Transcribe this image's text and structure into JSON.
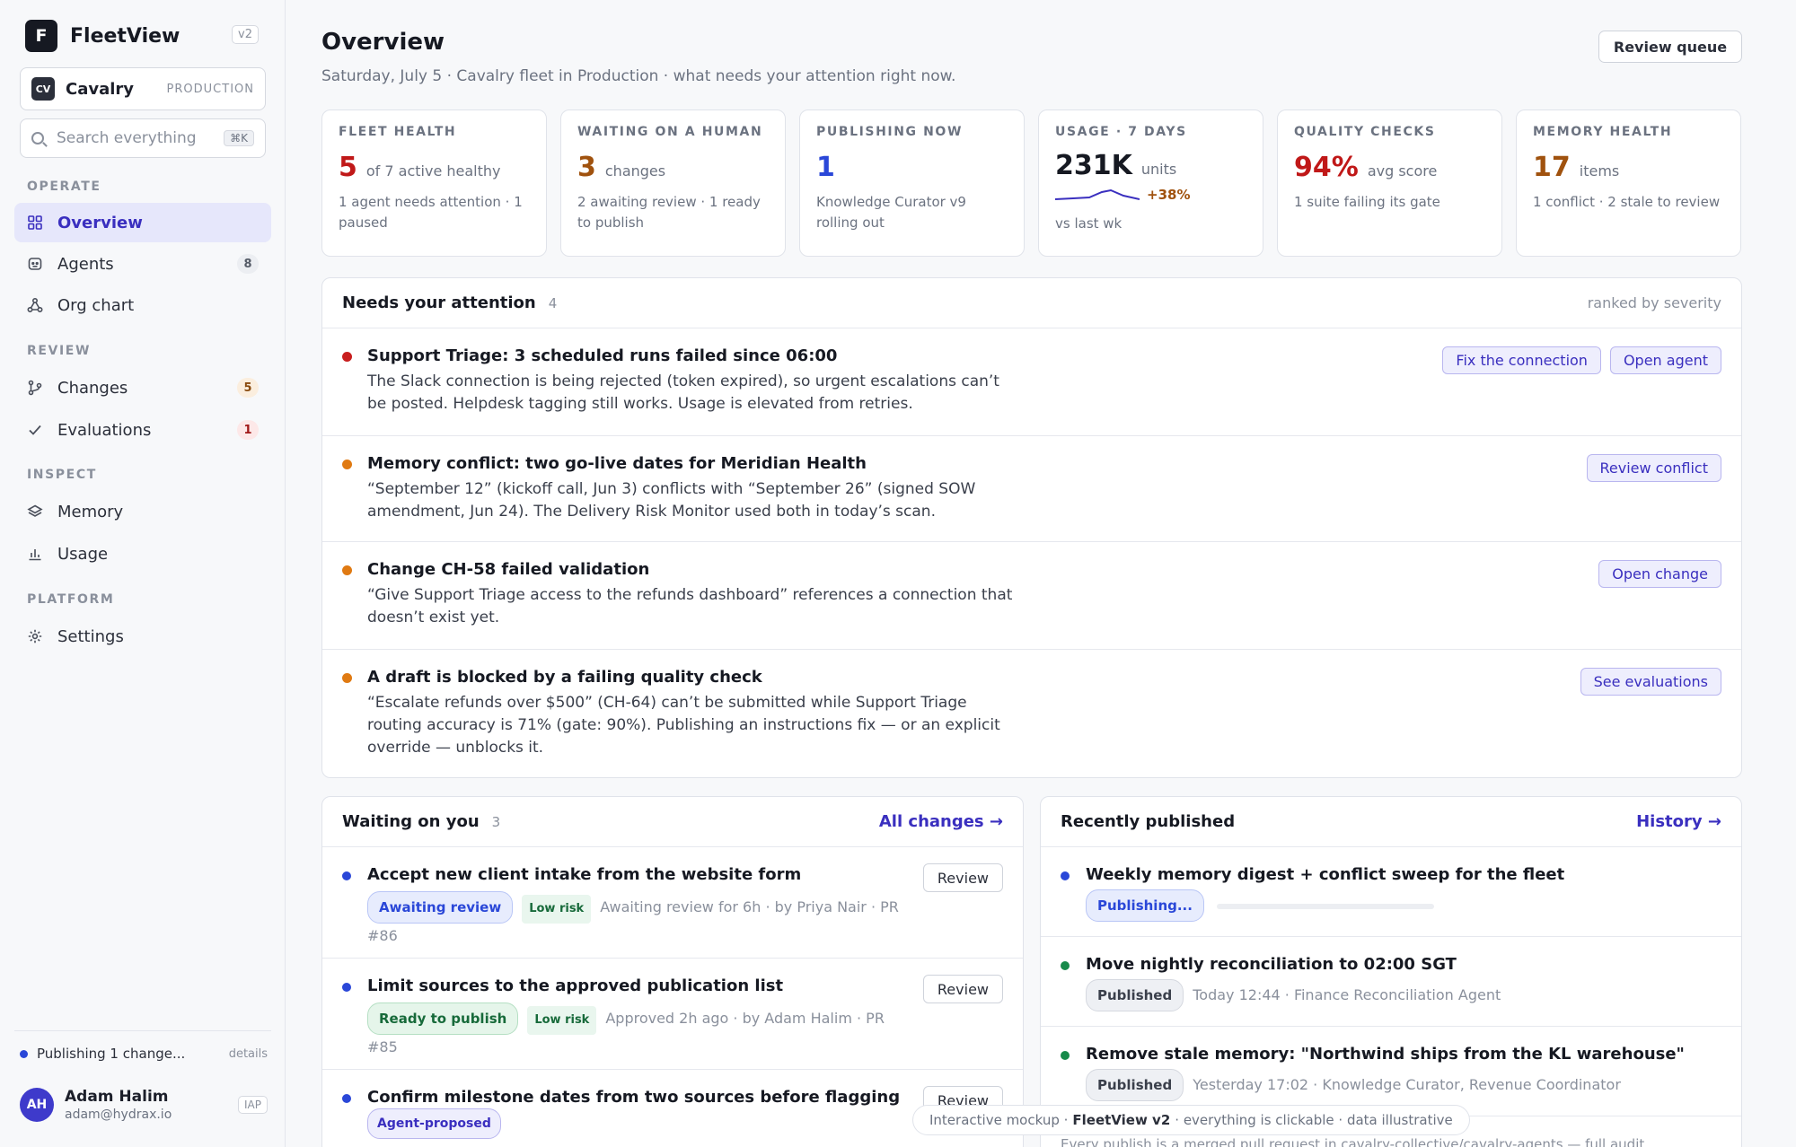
{
  "app": {
    "name": "FleetView",
    "version": "v2",
    "logo_letter": "F"
  },
  "org": {
    "badge": "CV",
    "name": "Cavalry",
    "env": "PRODUCTION"
  },
  "search": {
    "placeholder": "Search everything",
    "shortcut": "⌘K"
  },
  "nav": {
    "sections": [
      "OPERATE",
      "REVIEW",
      "INSPECT",
      "PLATFORM"
    ],
    "items": [
      {
        "label": "Overview",
        "icon": "grid-icon",
        "count": ""
      },
      {
        "label": "Agents",
        "icon": "agent-icon",
        "count": "8"
      },
      {
        "label": "Org chart",
        "icon": "org-chart-icon",
        "count": ""
      },
      {
        "label": "Changes",
        "icon": "git-branch-icon",
        "count": "5"
      },
      {
        "label": "Evaluations",
        "icon": "check-icon",
        "count": "1"
      },
      {
        "label": "Memory",
        "icon": "layers-icon",
        "count": ""
      },
      {
        "label": "Usage",
        "icon": "bar-chart-icon",
        "count": ""
      },
      {
        "label": "Settings",
        "icon": "gear-icon",
        "count": ""
      }
    ]
  },
  "sidebar_footer": {
    "publishing_text": "Publishing 1 change...",
    "details_link": "details",
    "user": {
      "initials": "AH",
      "name": "Adam Halim",
      "email": "adam@hydrax.io",
      "tag": "IAP"
    }
  },
  "header": {
    "title": "Overview",
    "subtitle": "Saturday, July 5 · Cavalry fleet in Production · what needs your attention right now.",
    "review_queue": "Review queue"
  },
  "stats": [
    {
      "label": "FLEET HEALTH",
      "value": "5",
      "unit": "of 7 active healthy",
      "note": "1 agent needs attention · 1 paused"
    },
    {
      "label": "WAITING ON A HUMAN",
      "value": "3",
      "unit": "changes",
      "note": "2 awaiting review · 1 ready to publish"
    },
    {
      "label": "PUBLISHING NOW",
      "value": "1",
      "unit": "",
      "note": "Knowledge Curator v9 rolling out"
    },
    {
      "label": "USAGE · 7 DAYS",
      "value": "231K",
      "unit": "units",
      "delta": "+38%",
      "note": "vs last wk"
    },
    {
      "label": "QUALITY CHECKS",
      "value": "94%",
      "unit": "avg score",
      "note": "1 suite failing its gate"
    },
    {
      "label": "MEMORY HEALTH",
      "value": "17",
      "unit": "items",
      "note": "1 conflict · 2 stale to review"
    }
  ],
  "colors": {
    "accent": "#3a2fbf",
    "red": "#c01818",
    "orange": "#a0520e",
    "blue": "#2a47d8",
    "green": "#178a4a"
  },
  "attention": {
    "title": "Needs your attention",
    "count": "4",
    "aside": "ranked by severity",
    "items": [
      {
        "title": "Support Triage: 3 scheduled runs failed since 06:00",
        "desc": "The Slack connection is being rejected (token expired), so urgent escalations can’t be posted. Helpdesk tagging still works. Usage is elevated from retries.",
        "actions": [
          "Fix the connection",
          "Open agent"
        ]
      },
      {
        "title": "Memory conflict: two go-live dates for Meridian Health",
        "desc": "“September 12” (kickoff call, Jun 3) conflicts with “September 26” (signed SOW amendment, Jun 24). The Delivery Risk Monitor used both in today’s scan.",
        "actions": [
          "Review conflict"
        ]
      },
      {
        "title": "Change CH-58 failed validation",
        "desc": "“Give Support Triage access to the refunds dashboard” references a connection that doesn’t exist yet.",
        "actions": [
          "Open change"
        ]
      },
      {
        "title": "A draft is blocked by a failing quality check",
        "desc": "“Escalate refunds over $500” (CH-64) can’t be submitted while Support Triage routing accuracy is 71% (gate: 90%). Publishing an instructions fix — or an explicit override — unblocks it.",
        "actions": [
          "See evaluations"
        ]
      }
    ]
  },
  "waiting": {
    "title": "Waiting on you",
    "count": "3",
    "link": "All changes →",
    "items": [
      {
        "title": "Accept new client intake from the website form",
        "status": "Awaiting review",
        "risk": "Low risk",
        "meta": "Awaiting review for 6h · by Priya Nair · PR #86",
        "button": "Review"
      },
      {
        "title": "Limit sources to the approved publication list",
        "status": "Ready to publish",
        "risk": "Low risk",
        "meta": "Approved 2h ago · by Adam Halim · PR #85",
        "button": "Review"
      },
      {
        "title": "Confirm milestone dates from two sources before flagging",
        "status": "Agent-proposed",
        "risk": "",
        "meta": "",
        "button": "Review"
      }
    ]
  },
  "published": {
    "title": "Recently published",
    "link": "History →",
    "items": [
      {
        "title": "Weekly memory digest + conflict sweep for the fleet",
        "status": "Publishing...",
        "meta": "",
        "progress": 0.0
      },
      {
        "title": "Move nightly reconciliation to 02:00 SGT",
        "status": "Published",
        "meta": "Today 12:44 · Finance Reconciliation Agent"
      },
      {
        "title": "Remove stale memory: \"Northwind ships from the KL warehouse\"",
        "status": "Published",
        "meta": "Yesterday 17:02 · Knowledge Curator, Revenue Coordinator"
      }
    ],
    "footnote": "Every publish is a merged pull request in cavalry-collective/cavalry-agents — full audit"
  },
  "toast": {
    "prefix": "Interactive mockup ·",
    "product": "FleetView v2",
    "suffix": "· everything is clickable · data illustrative"
  }
}
